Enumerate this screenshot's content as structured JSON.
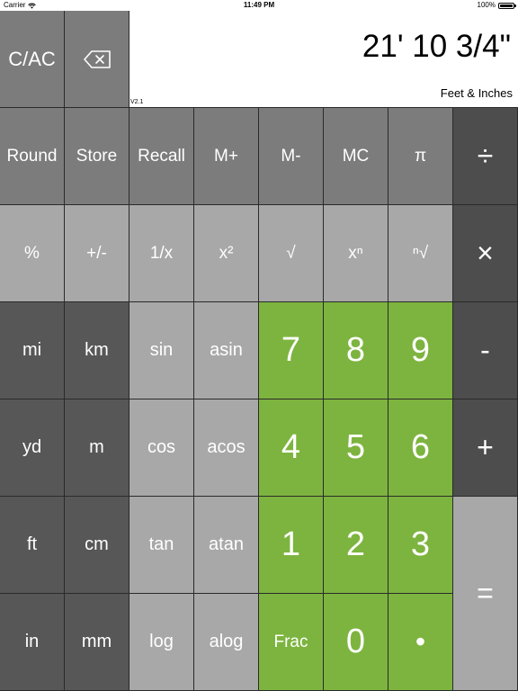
{
  "status": {
    "carrier": "Carrier",
    "time": "11:49 PM",
    "battery": "100%"
  },
  "display": {
    "value": "21' 10 3/4\"",
    "unit": "Feet & Inches",
    "version": "V2.1"
  },
  "keys": {
    "clear": "C/AC",
    "round": "Round",
    "store": "Store",
    "recall": "Recall",
    "mplus": "M+",
    "mminus": "M-",
    "mc": "MC",
    "pi": "π",
    "divide": "÷",
    "percent": "%",
    "negate": "+/-",
    "reciprocal": "1/x",
    "square": "x²",
    "sqrt": "√",
    "power": "xⁿ",
    "nthroot": "ⁿ√",
    "multiply": "×",
    "mi": "mi",
    "km": "km",
    "sin": "sin",
    "asin": "asin",
    "d7": "7",
    "d8": "8",
    "d9": "9",
    "minus": "-",
    "yd": "yd",
    "m": "m",
    "cos": "cos",
    "acos": "acos",
    "d4": "4",
    "d5": "5",
    "d6": "6",
    "plus": "+",
    "ft": "ft",
    "cm": "cm",
    "tan": "tan",
    "atan": "atan",
    "d1": "1",
    "d2": "2",
    "d3": "3",
    "equals": "=",
    "in": "in",
    "mm": "mm",
    "log": "log",
    "alog": "alog",
    "frac": "Frac",
    "d0": "0",
    "dot": "•"
  },
  "colors": {
    "green": "#7db43f",
    "dark": "#575757",
    "mid": "#7c7c7c",
    "light": "#a8a8a8",
    "operator": "#4d4d4d"
  }
}
